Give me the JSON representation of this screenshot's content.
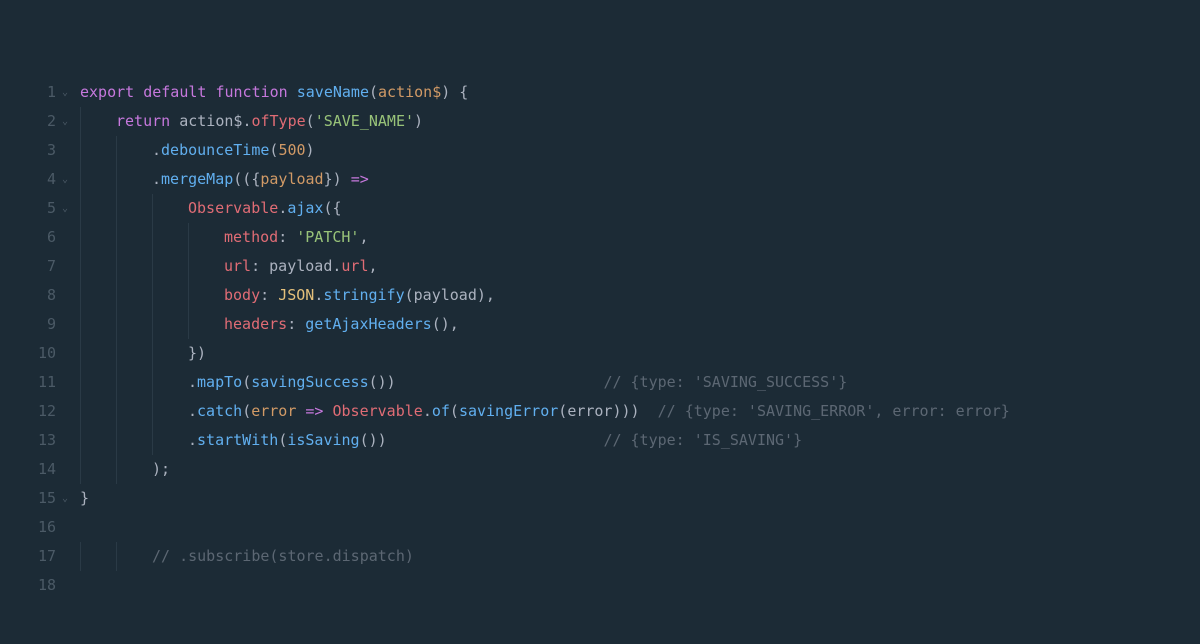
{
  "theme": {
    "background": "#1c2b36",
    "foreground": "#c0c5ce",
    "gutter": "#4b5a66",
    "indent_guide": "#2a3a46",
    "keyword": "#c678dd",
    "function": "#61afef",
    "param": "#d19a66",
    "property": "#e06c75",
    "punctuation": "#abb2bf",
    "string": "#98c379",
    "number": "#d19a66",
    "type": "#e5c07b",
    "comment": "#5c6773"
  },
  "lines": [
    {
      "num": "1",
      "foldable": true,
      "indent": 0,
      "tokens": [
        {
          "c": "kw",
          "t": "export "
        },
        {
          "c": "kw",
          "t": "default "
        },
        {
          "c": "kw",
          "t": "function "
        },
        {
          "c": "fn",
          "t": "saveName"
        },
        {
          "c": "punc",
          "t": "("
        },
        {
          "c": "param",
          "t": "action$"
        },
        {
          "c": "punc",
          "t": ") {"
        }
      ]
    },
    {
      "num": "2",
      "foldable": true,
      "indent": 1,
      "tokens": [
        {
          "c": "kw",
          "t": "return "
        },
        {
          "c": "plain",
          "t": "action$"
        },
        {
          "c": "punc",
          "t": "."
        },
        {
          "c": "prop",
          "t": "ofType"
        },
        {
          "c": "punc",
          "t": "("
        },
        {
          "c": "str",
          "t": "'SAVE_NAME'"
        },
        {
          "c": "punc",
          "t": ")"
        }
      ]
    },
    {
      "num": "3",
      "foldable": false,
      "indent": 2,
      "tokens": [
        {
          "c": "punc",
          "t": "."
        },
        {
          "c": "fn",
          "t": "debounceTime"
        },
        {
          "c": "punc",
          "t": "("
        },
        {
          "c": "num",
          "t": "500"
        },
        {
          "c": "punc",
          "t": ")"
        }
      ]
    },
    {
      "num": "4",
      "foldable": true,
      "indent": 2,
      "tokens": [
        {
          "c": "punc",
          "t": "."
        },
        {
          "c": "fn",
          "t": "mergeMap"
        },
        {
          "c": "punc",
          "t": "(({"
        },
        {
          "c": "param",
          "t": "payload"
        },
        {
          "c": "punc",
          "t": "}) "
        },
        {
          "c": "kw",
          "t": "=>"
        }
      ]
    },
    {
      "num": "5",
      "foldable": true,
      "indent": 3,
      "tokens": [
        {
          "c": "prop",
          "t": "Observable"
        },
        {
          "c": "punc",
          "t": "."
        },
        {
          "c": "fn",
          "t": "ajax"
        },
        {
          "c": "punc",
          "t": "({"
        }
      ]
    },
    {
      "num": "6",
      "foldable": false,
      "indent": 4,
      "tokens": [
        {
          "c": "prop",
          "t": "method"
        },
        {
          "c": "punc",
          "t": ": "
        },
        {
          "c": "str",
          "t": "'PATCH'"
        },
        {
          "c": "punc",
          "t": ","
        }
      ]
    },
    {
      "num": "7",
      "foldable": false,
      "indent": 4,
      "tokens": [
        {
          "c": "prop",
          "t": "url"
        },
        {
          "c": "punc",
          "t": ": "
        },
        {
          "c": "plain",
          "t": "payload"
        },
        {
          "c": "punc",
          "t": "."
        },
        {
          "c": "prop",
          "t": "url"
        },
        {
          "c": "punc",
          "t": ","
        }
      ]
    },
    {
      "num": "8",
      "foldable": false,
      "indent": 4,
      "tokens": [
        {
          "c": "prop",
          "t": "body"
        },
        {
          "c": "punc",
          "t": ": "
        },
        {
          "c": "type",
          "t": "JSON"
        },
        {
          "c": "punc",
          "t": "."
        },
        {
          "c": "fn",
          "t": "stringify"
        },
        {
          "c": "punc",
          "t": "("
        },
        {
          "c": "plain",
          "t": "payload"
        },
        {
          "c": "punc",
          "t": "),"
        }
      ]
    },
    {
      "num": "9",
      "foldable": false,
      "indent": 4,
      "tokens": [
        {
          "c": "prop",
          "t": "headers"
        },
        {
          "c": "punc",
          "t": ": "
        },
        {
          "c": "fn",
          "t": "getAjaxHeaders"
        },
        {
          "c": "punc",
          "t": "(),"
        }
      ]
    },
    {
      "num": "10",
      "foldable": false,
      "indent": 3,
      "tokens": [
        {
          "c": "punc",
          "t": "})"
        }
      ]
    },
    {
      "num": "11",
      "foldable": false,
      "indent": 3,
      "tokens": [
        {
          "c": "punc",
          "t": "."
        },
        {
          "c": "fn",
          "t": "mapTo"
        },
        {
          "c": "punc",
          "t": "("
        },
        {
          "c": "fn",
          "t": "savingSuccess"
        },
        {
          "c": "punc",
          "t": "())"
        },
        {
          "c": "plain",
          "t": "                       "
        },
        {
          "c": "cmt",
          "t": "// {type: 'SAVING_SUCCESS'}"
        }
      ]
    },
    {
      "num": "12",
      "foldable": false,
      "indent": 3,
      "tokens": [
        {
          "c": "punc",
          "t": "."
        },
        {
          "c": "fn",
          "t": "catch"
        },
        {
          "c": "punc",
          "t": "("
        },
        {
          "c": "param",
          "t": "error "
        },
        {
          "c": "kw",
          "t": "=> "
        },
        {
          "c": "prop",
          "t": "Observable"
        },
        {
          "c": "punc",
          "t": "."
        },
        {
          "c": "fn",
          "t": "of"
        },
        {
          "c": "punc",
          "t": "("
        },
        {
          "c": "fn",
          "t": "savingError"
        },
        {
          "c": "punc",
          "t": "("
        },
        {
          "c": "plain",
          "t": "error"
        },
        {
          "c": "punc",
          "t": ")))  "
        },
        {
          "c": "cmt",
          "t": "// {type: 'SAVING_ERROR', error: error}"
        }
      ]
    },
    {
      "num": "13",
      "foldable": false,
      "indent": 3,
      "tokens": [
        {
          "c": "punc",
          "t": "."
        },
        {
          "c": "fn",
          "t": "startWith"
        },
        {
          "c": "punc",
          "t": "("
        },
        {
          "c": "fn",
          "t": "isSaving"
        },
        {
          "c": "punc",
          "t": "())"
        },
        {
          "c": "plain",
          "t": "                        "
        },
        {
          "c": "cmt",
          "t": "// {type: 'IS_SAVING'}"
        }
      ]
    },
    {
      "num": "14",
      "foldable": false,
      "indent": 2,
      "tokens": [
        {
          "c": "punc",
          "t": ");"
        }
      ]
    },
    {
      "num": "15",
      "foldable": true,
      "indent": 0,
      "tokens": [
        {
          "c": "punc",
          "t": "}"
        }
      ]
    },
    {
      "num": "16",
      "foldable": false,
      "indent": 0,
      "tokens": []
    },
    {
      "num": "17",
      "foldable": false,
      "indent": 2,
      "tokens": [
        {
          "c": "cmt",
          "t": "// .subscribe(store.dispatch)"
        }
      ]
    },
    {
      "num": "18",
      "foldable": false,
      "indent": 0,
      "tokens": []
    }
  ],
  "fold_glyph": "⌄"
}
